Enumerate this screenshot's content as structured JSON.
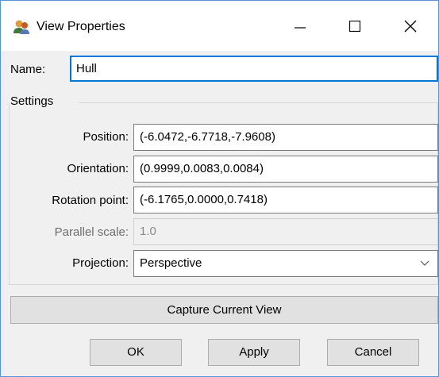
{
  "window": {
    "title": "View Properties"
  },
  "name": {
    "label": "Name:",
    "value": "Hull"
  },
  "settings": {
    "group_title": "Settings",
    "position": {
      "label": "Position:",
      "value": "(-6.0472,-6.7718,-7.9608)"
    },
    "orientation": {
      "label": "Orientation:",
      "value": "(0.9999,0.0083,0.0084)"
    },
    "rotation_point": {
      "label": "Rotation point:",
      "value": "(-6.1765,0.0000,0.7418)"
    },
    "parallel_scale": {
      "label": "Parallel scale:",
      "value": "1.0",
      "disabled": true
    },
    "projection": {
      "label": "Projection:",
      "value": "Perspective"
    }
  },
  "capture_button": {
    "label": "Capture Current View"
  },
  "buttons": {
    "ok": "OK",
    "apply": "Apply",
    "cancel": "Cancel"
  },
  "colors": {
    "focus_border": "#0078d7",
    "window_border": "#5b8fd6",
    "dialog_bg": "#f0f0f0",
    "button_bg": "#e1e1e1"
  },
  "icons": {
    "app": "people-icon",
    "minimize": "minimize-icon",
    "maximize": "maximize-icon",
    "close": "close-icon",
    "dropdown": "chevron-down-icon"
  }
}
